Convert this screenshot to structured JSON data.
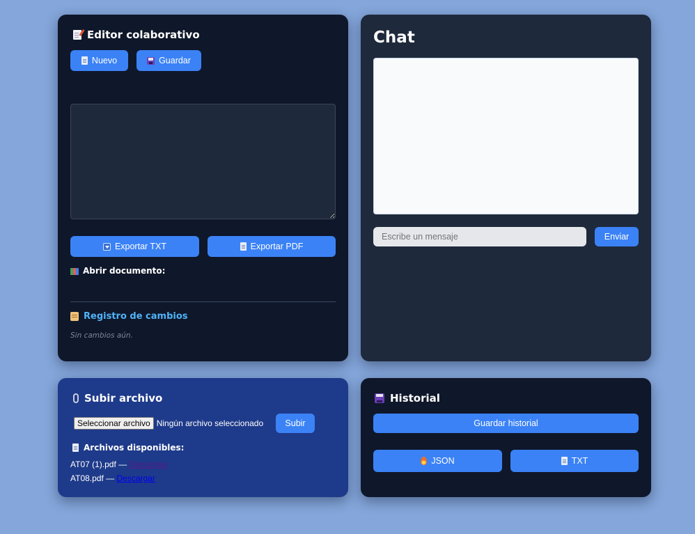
{
  "editor": {
    "title": "Editor colaborativo",
    "new_label": "Nuevo",
    "save_label": "Guardar",
    "text_value": "",
    "export_txt_label": "Exportar TXT",
    "export_pdf_label": "Exportar PDF",
    "open_doc_label": "Abrir documento:",
    "changelog_title": "Registro de cambios",
    "changelog_empty": "Sin cambios aún."
  },
  "chat": {
    "title": "Chat",
    "input_placeholder": "Escribe un mensaje",
    "send_label": "Enviar"
  },
  "upload": {
    "title": "Subir archivo",
    "choose_label": "Seleccionar archivo",
    "no_file_text": "Ningún archivo seleccionado",
    "submit_label": "Subir",
    "files_title": "Archivos disponibles:",
    "files": [
      {
        "name": "AT07 (1).pdf",
        "separator": " — ",
        "link": "Descargar",
        "visited": true
      },
      {
        "name": "AT08.pdf",
        "separator": " — ",
        "link": "Descargar",
        "visited": false
      }
    ]
  },
  "history": {
    "title": "Historial",
    "save_label": "Guardar historial",
    "json_label": "JSON",
    "txt_label": "TXT"
  },
  "colors": {
    "page_bg": "#84a6da",
    "card_dark": "#0f172a",
    "card_slate": "#1e293b",
    "card_blue": "#1e3a8a",
    "accent": "#3b82f6",
    "link_heading": "#4fb3f6"
  },
  "icons": {
    "editor_title": "memo-icon",
    "new": "document-icon",
    "save": "floppy-disk-icon",
    "export_txt": "down-arrow-icon",
    "export_pdf": "document-icon",
    "open_doc": "books-icon",
    "changelog": "scroll-icon",
    "upload": "paperclip-icon",
    "files": "document-icon",
    "history": "floppy-disk-icon",
    "json": "fire-icon",
    "txt": "document-icon"
  }
}
